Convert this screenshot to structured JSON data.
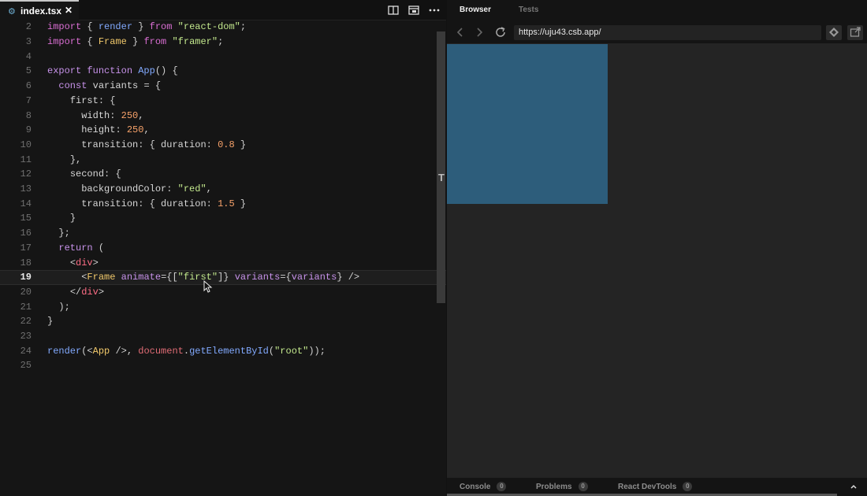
{
  "editor": {
    "tab": {
      "icon": "gear-icon",
      "label": "index.tsx",
      "close": "✕"
    },
    "active_line": 19,
    "lines": [
      {
        "n": "2",
        "text": "import { render } from \"react-dom\";"
      },
      {
        "n": "3",
        "text": "import { Frame } from \"framer\";"
      },
      {
        "n": "4",
        "text": ""
      },
      {
        "n": "5",
        "text": "export function App() {"
      },
      {
        "n": "6",
        "text": "  const variants = {"
      },
      {
        "n": "7",
        "text": "    first: {"
      },
      {
        "n": "8",
        "text": "      width: 250,"
      },
      {
        "n": "9",
        "text": "      height: 250,"
      },
      {
        "n": "10",
        "text": "      transition: { duration: 0.8 }"
      },
      {
        "n": "11",
        "text": "    },"
      },
      {
        "n": "12",
        "text": "    second: {"
      },
      {
        "n": "13",
        "text": "      backgroundColor: \"red\","
      },
      {
        "n": "14",
        "text": "      transition: { duration: 1.5 }"
      },
      {
        "n": "15",
        "text": "    }"
      },
      {
        "n": "16",
        "text": "  };"
      },
      {
        "n": "17",
        "text": "  return ("
      },
      {
        "n": "18",
        "text": "    <div>"
      },
      {
        "n": "19",
        "text": "      <Frame animate={[\"first\"]} variants={variants} />"
      },
      {
        "n": "20",
        "text": "    </div>"
      },
      {
        "n": "21",
        "text": "  );"
      },
      {
        "n": "22",
        "text": "}"
      },
      {
        "n": "23",
        "text": ""
      },
      {
        "n": "24",
        "text": "render(<App />, document.getElementById(\"root\"));"
      },
      {
        "n": "25",
        "text": ""
      }
    ]
  },
  "browser": {
    "tabs": {
      "browser": "Browser",
      "tests": "Tests"
    },
    "url": "https://uju43.csb.app/",
    "preview_box_color": "#2d5d7b",
    "devtools": {
      "console": {
        "label": "Console",
        "count": "0"
      },
      "problems": {
        "label": "Problems",
        "count": "0"
      },
      "react": {
        "label": "React DevTools",
        "count": "0"
      }
    }
  },
  "colors": {
    "accent": "#6fb1d6",
    "editor_bg": "#151515",
    "browser_bg": "#242424"
  }
}
